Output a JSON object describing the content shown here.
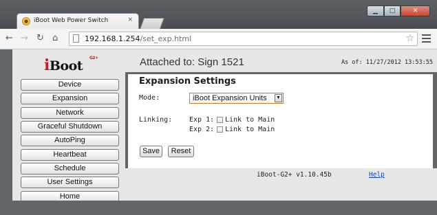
{
  "browser": {
    "tab_title": "iBoot Web Power Switch",
    "tab_close": "×",
    "url_host": "192.168.1.254",
    "url_path": "/set_exp.html"
  },
  "logo": {
    "text": "Boot",
    "initial": "i",
    "superscript": "G2+"
  },
  "sidebar": {
    "items": [
      {
        "label": "Device"
      },
      {
        "label": "Expansion"
      },
      {
        "label": "Network"
      },
      {
        "label": "Graceful Shutdown"
      },
      {
        "label": "AutoPing"
      },
      {
        "label": "Heartbeat"
      },
      {
        "label": "Schedule"
      },
      {
        "label": "User Settings"
      },
      {
        "label": "Home"
      }
    ]
  },
  "header": {
    "attached": "Attached to: Sign 1521",
    "as_of": "As of: 11/27/2012 13:53:55"
  },
  "form": {
    "title": "Expansion Settings",
    "mode_label": "Mode:",
    "mode_value": "iBoot Expansion Units",
    "linking_label": "Linking:",
    "exp1_label": "Exp 1:",
    "exp1_checkbox_label": "Link to Main",
    "exp2_label": "Exp 2:",
    "exp2_checkbox_label": "Link to Main",
    "save_label": "Save",
    "reset_label": "Reset"
  },
  "footer": {
    "version": "iBoot-G2+ v1.10.45b",
    "help": "Help"
  }
}
